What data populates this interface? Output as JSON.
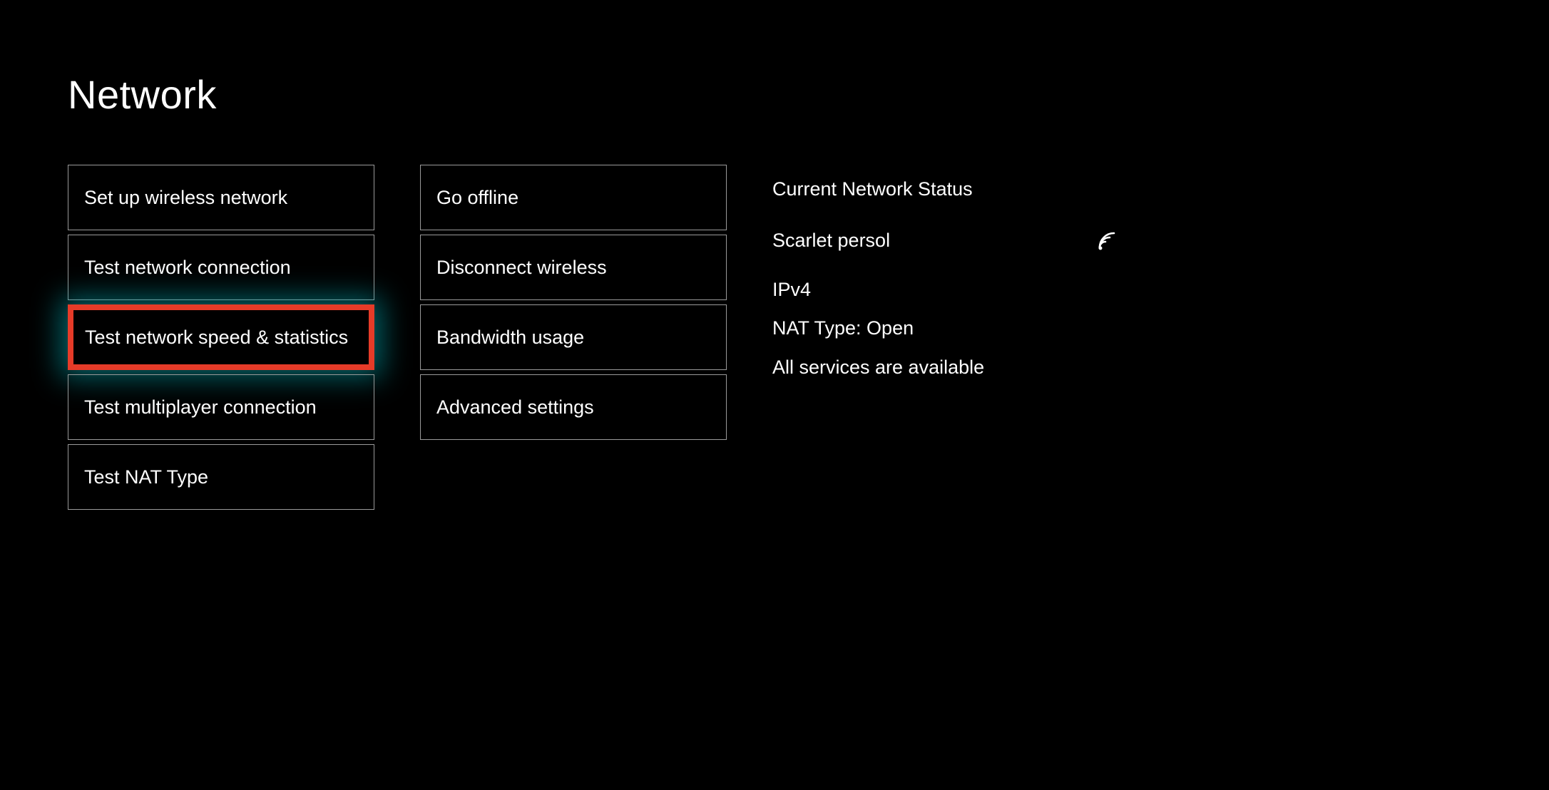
{
  "title": "Network",
  "columns": {
    "left": [
      {
        "id": "setup-wireless",
        "label": "Set up wireless network",
        "highlighted": false
      },
      {
        "id": "test-connection",
        "label": "Test network connection",
        "highlighted": false
      },
      {
        "id": "test-speed-stats",
        "label": "Test network speed & statistics",
        "highlighted": true
      },
      {
        "id": "test-multiplayer",
        "label": "Test multiplayer connection",
        "highlighted": false
      },
      {
        "id": "test-nat-type",
        "label": "Test NAT Type",
        "highlighted": false
      }
    ],
    "right": [
      {
        "id": "go-offline",
        "label": "Go offline",
        "highlighted": false
      },
      {
        "id": "disconnect-wireless",
        "label": "Disconnect wireless",
        "highlighted": false
      },
      {
        "id": "bandwidth-usage",
        "label": "Bandwidth usage",
        "highlighted": false
      },
      {
        "id": "advanced-settings",
        "label": "Advanced settings",
        "highlighted": false
      }
    ]
  },
  "status": {
    "heading": "Current Network Status",
    "network_name": "Scarlet persol",
    "ip_version": "IPv4",
    "nat_type": "NAT Type: Open",
    "services": "All services are available"
  }
}
